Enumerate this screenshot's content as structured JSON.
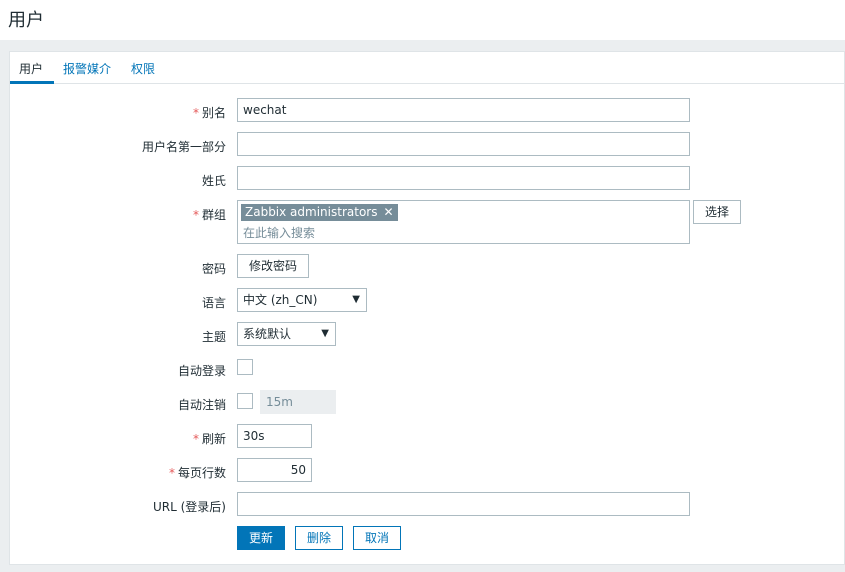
{
  "page": {
    "title": "用户"
  },
  "tabs": [
    {
      "label": "用户"
    },
    {
      "label": "报警媒介"
    },
    {
      "label": "权限"
    }
  ],
  "form": {
    "alias": {
      "label": "别名",
      "required": true,
      "value": "wechat"
    },
    "name": {
      "label": "用户名第一部分",
      "value": ""
    },
    "surname": {
      "label": "姓氏",
      "value": ""
    },
    "groups": {
      "label": "群组",
      "required": true,
      "selected": [
        "Zabbix administrators"
      ],
      "placeholder": "在此输入搜索",
      "select_button": "选择"
    },
    "password": {
      "label": "密码",
      "button": "修改密码"
    },
    "language": {
      "label": "语言",
      "value": "中文 (zh_CN)"
    },
    "theme": {
      "label": "主题",
      "value": "系统默认"
    },
    "autologin": {
      "label": "自动登录",
      "checked": false
    },
    "autologout": {
      "label": "自动注销",
      "checked": false,
      "value": "15m"
    },
    "refresh": {
      "label": "刷新",
      "required": true,
      "value": "30s"
    },
    "rows_per_page": {
      "label": "每页行数",
      "required": true,
      "value": "50"
    },
    "url": {
      "label": "URL (登录后)",
      "value": ""
    }
  },
  "buttons": {
    "update": "更新",
    "delete": "删除",
    "cancel": "取消"
  },
  "colors": {
    "accent": "#0275b8",
    "required": "#e45959",
    "chip": "#768d99"
  },
  "icons": {
    "chip_remove": "close-icon",
    "dropdown": "chevron-down-icon"
  }
}
